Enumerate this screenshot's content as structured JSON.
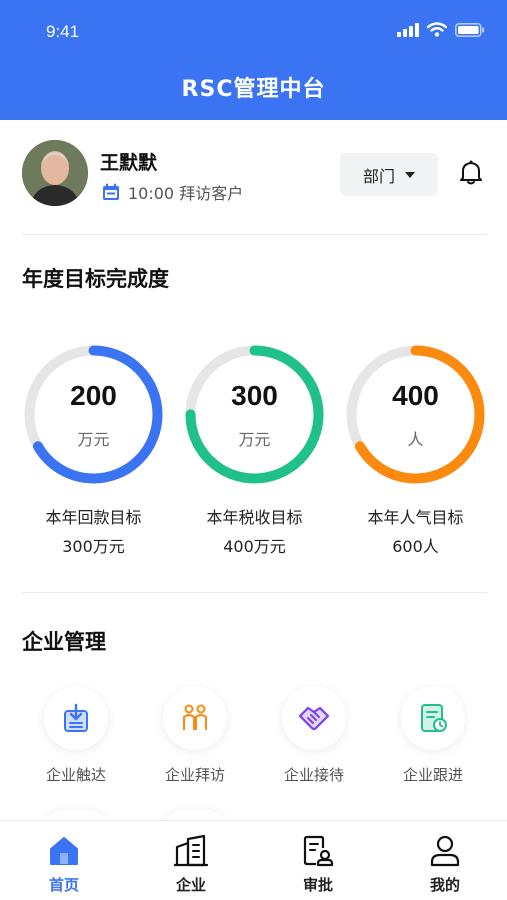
{
  "status": {
    "time": "9:41"
  },
  "header": {
    "title": "RSC管理中台"
  },
  "profile": {
    "name": "王默默",
    "schedule": "10:00 拜访客户",
    "dept_label": "部门"
  },
  "goals": {
    "title": "年度目标完成度",
    "items": [
      {
        "value": "200",
        "unit": "万元",
        "label": "本年回款目标",
        "target": "300万元",
        "progress": 0.667,
        "color": "#3b74f2"
      },
      {
        "value": "300",
        "unit": "万元",
        "label": "本年税收目标",
        "target": "400万元",
        "progress": 0.75,
        "color": "#1fc08a"
      },
      {
        "value": "400",
        "unit": "人",
        "label": "本年人气目标",
        "target": "600人",
        "progress": 0.667,
        "color": "#fb8a0e"
      }
    ]
  },
  "management": {
    "title": "企业管理",
    "items": [
      {
        "label": "企业触达",
        "icon": "download-clipboard-icon",
        "color": "#3b74f2"
      },
      {
        "label": "企业拜访",
        "icon": "people-icon",
        "color": "#fb8a0e"
      },
      {
        "label": "企业接待",
        "icon": "handshake-icon",
        "color": "#7b3ff2"
      },
      {
        "label": "企业跟进",
        "icon": "document-clock-icon",
        "color": "#1fc08a"
      }
    ]
  },
  "tabs": [
    {
      "label": "首页",
      "icon": "home-icon",
      "active": true
    },
    {
      "label": "企业",
      "icon": "building-icon",
      "active": false
    },
    {
      "label": "审批",
      "icon": "approval-icon",
      "active": false
    },
    {
      "label": "我的",
      "icon": "user-icon",
      "active": false
    }
  ],
  "colors": {
    "primary": "#3b74f2",
    "track": "#e6e6e6"
  }
}
